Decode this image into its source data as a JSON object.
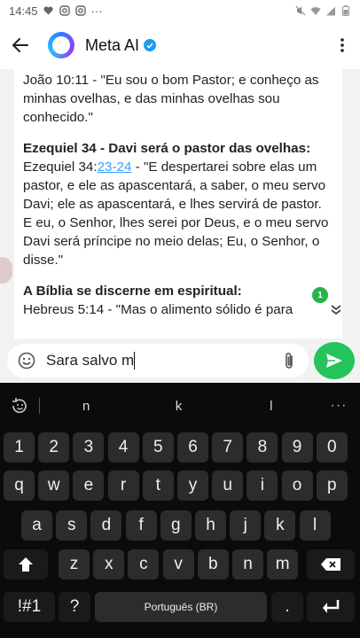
{
  "status_bar": {
    "time": "14:45",
    "more": "···"
  },
  "header": {
    "title": "Meta AI"
  },
  "chat": {
    "para1": "João 10:11 - \"Eu sou o bom Pastor; e conheço as minhas ovelhas, e das minhas ovelhas sou conhecido.\"",
    "heading2": "Ezequiel 34 - Davi será o pastor das ovelhas:",
    "ref2_book": "Ezequiel 34:",
    "ref2_link": "23-24",
    "ref2_text": " - \"E despertarei sobre elas um pastor, e ele as apascentará, a saber, o meu servo Davi; ele as apascentará, e lhes servirá de pastor. E eu, o Senhor, lhes serei por Deus, e o meu servo Davi será príncipe no meio delas; Eu, o Senhor, o disse.\"",
    "heading3": "A Bíblia se discerne em espiritual:",
    "para3": "Hebreus 5:14 - \"Mas o alimento sólido é para",
    "unread_count": "1"
  },
  "composer": {
    "text": "Sara salvo m"
  },
  "keyboard": {
    "suggestions": [
      "n",
      "k",
      "l"
    ],
    "more": "···",
    "row_numbers": [
      "1",
      "2",
      "3",
      "4",
      "5",
      "6",
      "7",
      "8",
      "9",
      "0"
    ],
    "row_top": [
      "q",
      "w",
      "e",
      "r",
      "t",
      "y",
      "u",
      "i",
      "o",
      "p"
    ],
    "row_mid": [
      "a",
      "s",
      "d",
      "f",
      "g",
      "h",
      "j",
      "k",
      "l"
    ],
    "row_bottom": [
      "z",
      "x",
      "c",
      "v",
      "b",
      "n",
      "m"
    ],
    "symbols_key": "!#1",
    "comma_key": "?",
    "space_label": "Português (BR)",
    "period_key": "."
  },
  "colors": {
    "accent_green": "#25c35b",
    "link_blue": "#3aa0ff",
    "keyboard_bg": "#0b0b0b"
  }
}
